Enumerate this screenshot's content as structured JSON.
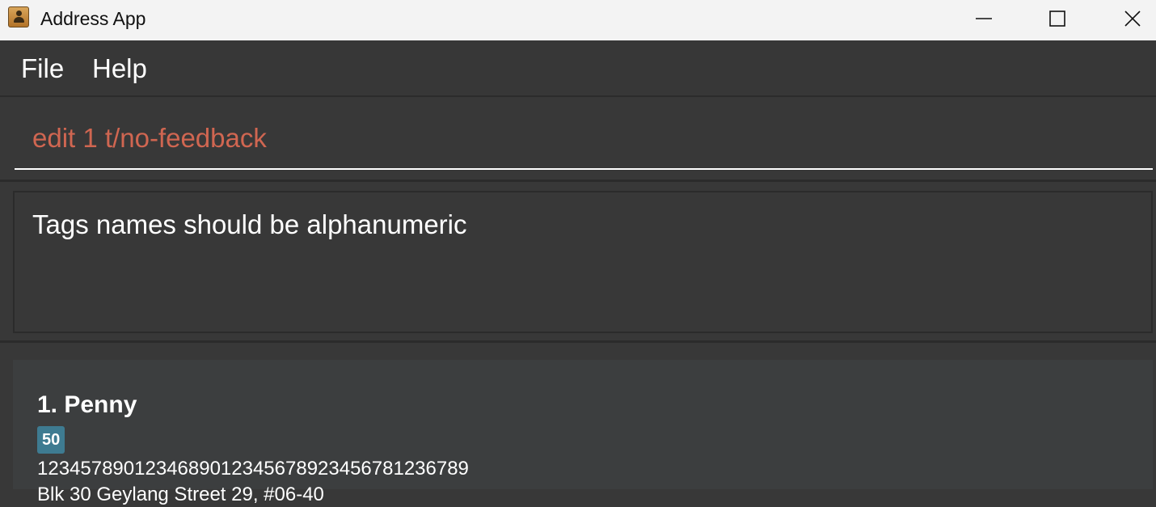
{
  "window": {
    "title": "Address App",
    "app_icon": "address-book-icon",
    "controls": [
      "minimize-icon",
      "maximize-icon",
      "close-icon"
    ]
  },
  "menu": {
    "items": [
      {
        "label": "File"
      },
      {
        "label": "Help"
      }
    ]
  },
  "command": {
    "value": "edit 1 t/no-feedback",
    "status": "error",
    "text_color": "#d06651"
  },
  "result": {
    "message": "Tags names should be alphanumeric"
  },
  "person_list": {
    "cards": [
      {
        "index_name": "1. Penny",
        "tags": [
          "50"
        ],
        "phone": "1234578901234689012345678923456781236789",
        "address": "Blk 30 Geylang Street 29, #06-40"
      }
    ]
  },
  "colors": {
    "titlebar": "#f3f3f3",
    "background": "#383838",
    "card": "#3c3e3f",
    "tag": "#3e7b91"
  }
}
